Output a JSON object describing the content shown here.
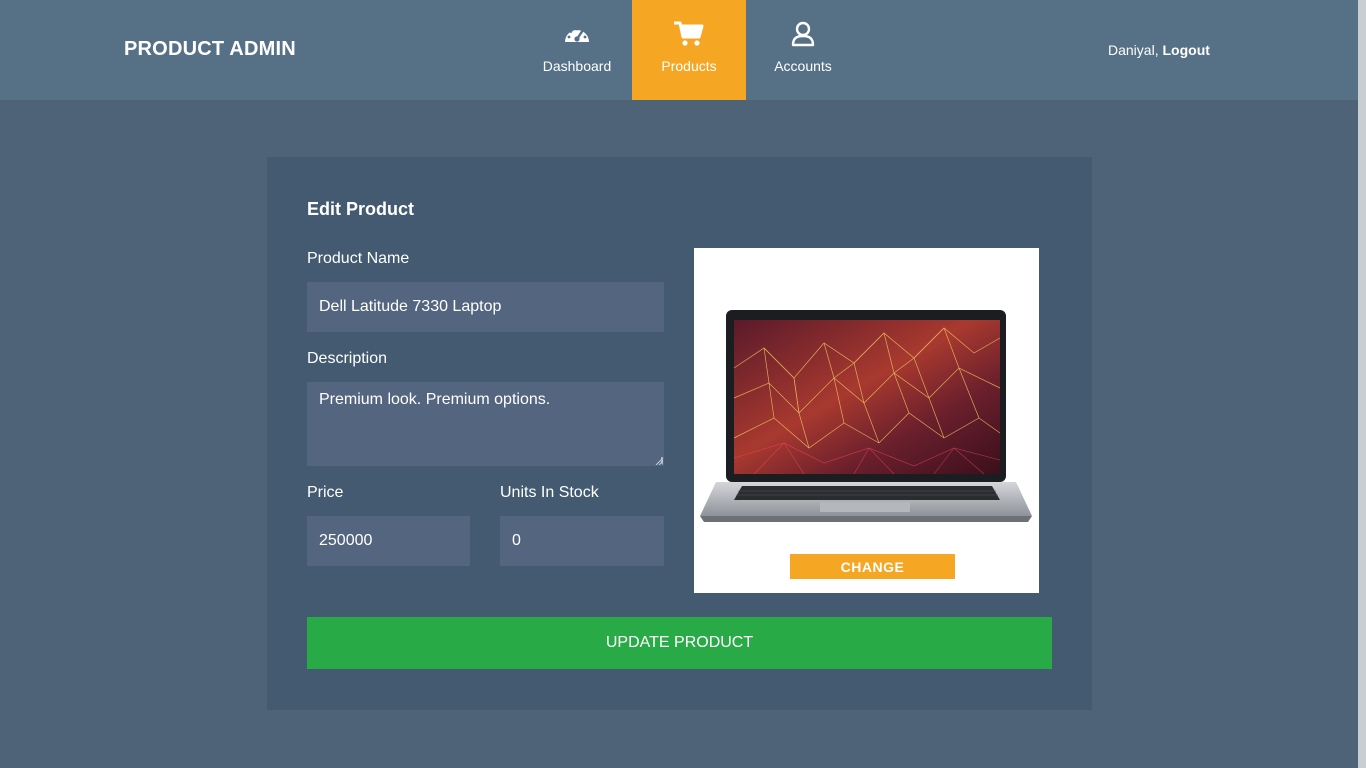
{
  "header": {
    "brand": "PRODUCT ADMIN",
    "nav": [
      {
        "label": "Dashboard",
        "icon": "speedometer-icon",
        "active": false
      },
      {
        "label": "Products",
        "icon": "shopping-cart-icon",
        "active": true
      },
      {
        "label": "Accounts",
        "icon": "user-icon",
        "active": false
      }
    ],
    "user_name": "Daniyal,",
    "logout_label": "Logout"
  },
  "form": {
    "title": "Edit Product",
    "product_name_label": "Product Name",
    "product_name_value": "Dell Latitude 7330 Laptop",
    "description_label": "Description",
    "description_value": "Premium look. Premium options.",
    "price_label": "Price",
    "price_value": "250000",
    "stock_label": "Units In Stock",
    "stock_value": "0",
    "change_label": "CHANGE",
    "update_label": "UPDATE PRODUCT"
  },
  "colors": {
    "accent": "#f5a623",
    "success": "#28ab47",
    "header_bg": "#567086",
    "page_bg": "#4e6278",
    "card_bg": "#435a70",
    "field_bg": "#54667f"
  }
}
